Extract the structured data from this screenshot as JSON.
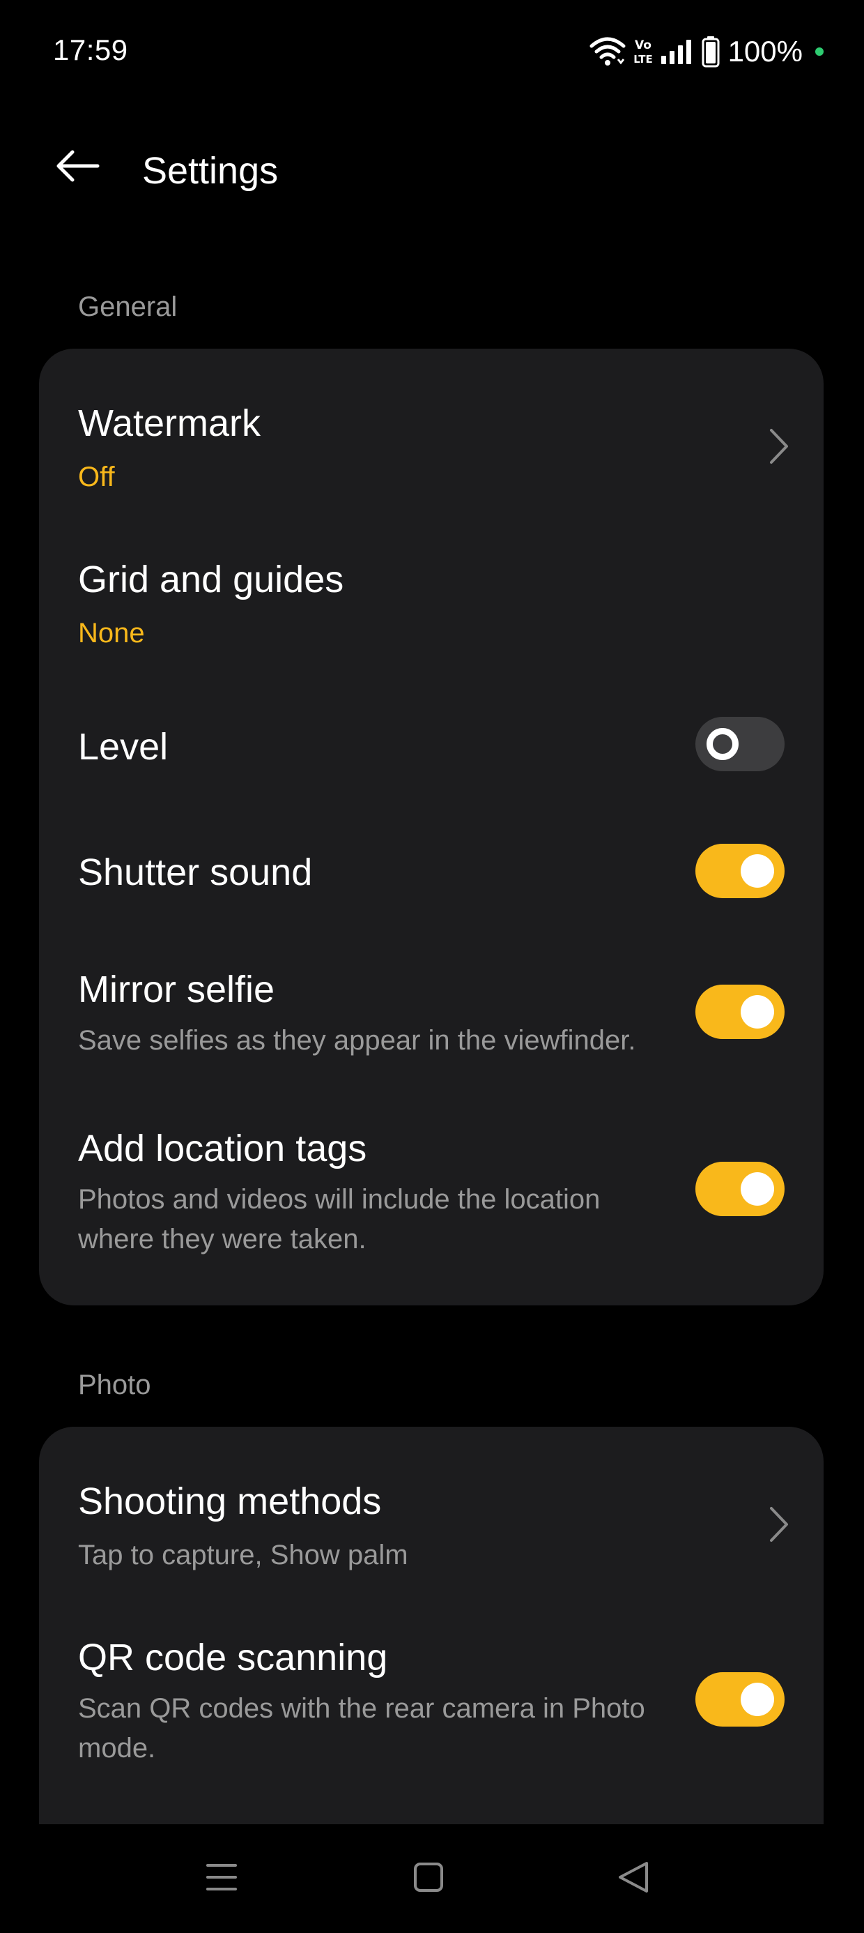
{
  "status_bar": {
    "time": "17:59",
    "battery_percent": "100%",
    "icons": [
      "wifi-icon",
      "volte-icon",
      "signal-icon",
      "battery-icon"
    ],
    "dot_color": "#2ecc71"
  },
  "header": {
    "title": "Settings",
    "back_icon": "arrow-left-icon"
  },
  "accent_color": "#f9b81b",
  "sections": {
    "general": {
      "label": "General",
      "items": {
        "watermark": {
          "title": "Watermark",
          "value": "Off",
          "type": "chevron"
        },
        "grid": {
          "title": "Grid and guides",
          "value": "None",
          "type": "plain"
        },
        "level": {
          "title": "Level",
          "type": "toggle",
          "enabled": false
        },
        "shutter_sound": {
          "title": "Shutter sound",
          "type": "toggle",
          "enabled": true
        },
        "mirror_selfie": {
          "title": "Mirror selfie",
          "subtitle": "Save selfies as they appear in the viewfinder.",
          "type": "toggle",
          "enabled": true
        },
        "location_tags": {
          "title": "Add location tags",
          "subtitle": "Photos and videos will include the location where they were taken.",
          "type": "toggle",
          "enabled": true
        }
      }
    },
    "photo": {
      "label": "Photo",
      "items": {
        "shooting_methods": {
          "title": "Shooting methods",
          "subtitle": "Tap to capture, Show palm",
          "type": "chevron"
        },
        "qr_scanning": {
          "title": "QR code scanning",
          "subtitle": "Scan QR codes with the rear camera in Photo mode.",
          "type": "toggle",
          "enabled": true
        }
      }
    }
  },
  "nav_bar": {
    "items": [
      "menu-icon",
      "home-square-icon",
      "back-triangle-icon"
    ]
  }
}
